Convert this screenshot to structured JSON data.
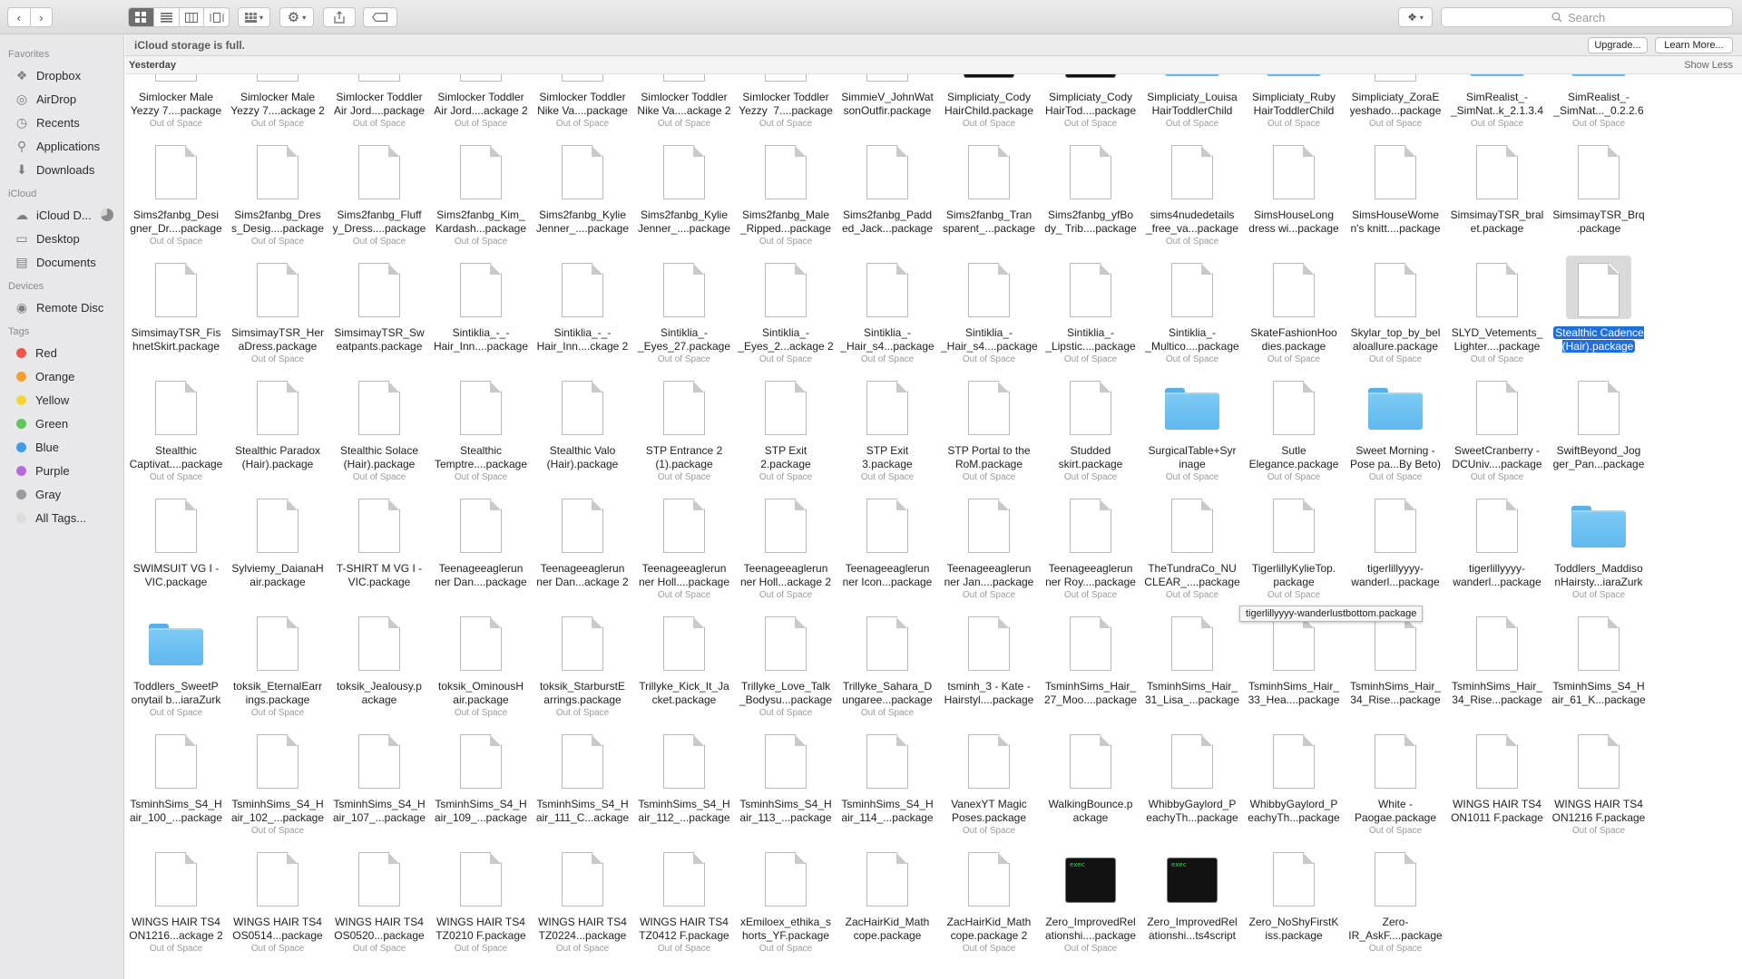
{
  "toolbar": {
    "nav_back_icon": "chevron-left",
    "nav_forward_icon": "chevron-right",
    "view_modes": [
      "icon-view",
      "list-view",
      "column-view",
      "coverflow-view"
    ],
    "arrange_icon": "grid-arrange",
    "action_icon": "gear",
    "share_icon": "share",
    "tags_icon": "tag",
    "dropbox_icon": "dropbox",
    "search_placeholder": "Search"
  },
  "sidebar": {
    "favorites_label": "Favorites",
    "favorites": [
      {
        "label": "Dropbox",
        "icon": "dropbox-icon"
      },
      {
        "label": "AirDrop",
        "icon": "airdrop-icon"
      },
      {
        "label": "Recents",
        "icon": "clock-icon"
      },
      {
        "label": "Applications",
        "icon": "applications-icon"
      },
      {
        "label": "Downloads",
        "icon": "download-icon"
      }
    ],
    "icloud_label": "iCloud",
    "icloud": [
      {
        "label": "iCloud D...",
        "icon": "cloud-icon"
      },
      {
        "label": "Desktop",
        "icon": "desktop-icon"
      },
      {
        "label": "Documents",
        "icon": "document-icon"
      }
    ],
    "devices_label": "Devices",
    "devices": [
      {
        "label": "Remote Disc",
        "icon": "disc-icon"
      }
    ],
    "tags_label": "Tags",
    "tags": [
      {
        "label": "Red",
        "color": "#f0544f"
      },
      {
        "label": "Orange",
        "color": "#f6a02d"
      },
      {
        "label": "Yellow",
        "color": "#f8d435"
      },
      {
        "label": "Green",
        "color": "#5fc65a"
      },
      {
        "label": "Blue",
        "color": "#3d9be9"
      },
      {
        "label": "Purple",
        "color": "#b66bd9"
      },
      {
        "label": "Gray",
        "color": "#9b9b9b"
      },
      {
        "label": "All Tags...",
        "color": "#dcdcdc"
      }
    ]
  },
  "banner": {
    "message": "iCloud storage is full.",
    "upgrade_label": "Upgrade...",
    "learn_more_label": "Learn More..."
  },
  "group": {
    "title": "Yesterday",
    "show_less_label": "Show Less"
  },
  "tooltip": "tigerlillyyyy-wanderlustbottom.package",
  "accent_color": "#1d6ee2",
  "files": [
    {
      "name": "Simlocker Male\nYezzy 7....package",
      "sub": "Out of Space",
      "kind": "doc"
    },
    {
      "name": "Simlocker Male\nYezzy 7....ackage 2",
      "sub": "Out of Space",
      "kind": "doc"
    },
    {
      "name": "Simlocker Toddler\nAir Jord....package",
      "sub": "Out of Space",
      "kind": "doc"
    },
    {
      "name": "Simlocker Toddler\nAir Jord....ackage 2",
      "sub": "Out of Space",
      "kind": "doc"
    },
    {
      "name": "Simlocker Toddler\nNike Va....package",
      "sub": "Out of Space",
      "kind": "doc"
    },
    {
      "name": "Simlocker Toddler\nNike Va....ackage 2",
      "sub": "Out of Space",
      "kind": "doc"
    },
    {
      "name": "Simlocker Toddler\nYezzy  7....package",
      "sub": "Out of Space",
      "kind": "doc"
    },
    {
      "name": "SimmieV_JohnWat\nsonOutfir.package",
      "sub": "",
      "kind": "doc"
    },
    {
      "name": "Simpliciaty_Cody\nHairChild.package",
      "sub": "Out of Space",
      "kind": "exec"
    },
    {
      "name": "Simpliciaty_Cody\nHairTod....package",
      "sub": "Out of Space",
      "kind": "exec"
    },
    {
      "name": "Simpliciaty_Louisa\nHairToddlerChild",
      "sub": "Out of Space",
      "kind": "folder"
    },
    {
      "name": "Simpliciaty_Ruby\nHairToddlerChild",
      "sub": "Out of Space",
      "kind": "folder"
    },
    {
      "name": "Simpliciaty_ZoraE\nyeshado...package",
      "sub": "Out of Space",
      "kind": "doc"
    },
    {
      "name": "SimRealist_-\n_SimNat..k_2.1.3.4",
      "sub": "Out of Space",
      "kind": "folder"
    },
    {
      "name": "SimRealist_-\n_SimNat..._0.2.2.6",
      "sub": "Out of Space",
      "kind": "folder"
    },
    {
      "name": "Sims2fanbg_Desi\ngner_Dr....package",
      "sub": "Out of Space",
      "kind": "doc"
    },
    {
      "name": "Sims2fanbg_Dres\ns_Desig....package",
      "sub": "Out of Space",
      "kind": "doc"
    },
    {
      "name": "Sims2fanbg_Fluff\ny_Dress....package",
      "sub": "Out of Space",
      "kind": "doc"
    },
    {
      "name": "Sims2fanbg_Kim_\nKardash...package",
      "sub": "Out of Space",
      "kind": "doc"
    },
    {
      "name": "Sims2fanbg_Kylie\nJenner_....package",
      "sub": "",
      "kind": "doc"
    },
    {
      "name": "Sims2fanbg_Kylie\nJenner_....package",
      "sub": "",
      "kind": "doc"
    },
    {
      "name": "Sims2fanbg_Male\n_Ripped...package",
      "sub": "Out of Space",
      "kind": "doc"
    },
    {
      "name": "Sims2fanbg_Padd\ned_Jack...package",
      "sub": "",
      "kind": "doc"
    },
    {
      "name": "Sims2fanbg_Tran\nsparent_...package",
      "sub": "",
      "kind": "doc"
    },
    {
      "name": "Sims2fanbg_yfBo\ndy_ Trib....package",
      "sub": "",
      "kind": "doc"
    },
    {
      "name": "sims4nudedetails\n_free_va...package",
      "sub": "Out of Space",
      "kind": "doc"
    },
    {
      "name": "SimsHouseLong\ndress wi...package",
      "sub": "",
      "kind": "doc"
    },
    {
      "name": "SimsHouseWome\nn's knitt....package",
      "sub": "",
      "kind": "doc"
    },
    {
      "name": "SimsimayTSR_bral\net.package",
      "sub": "",
      "kind": "doc"
    },
    {
      "name": "SimsimayTSR_Brq\n.package",
      "sub": "",
      "kind": "doc"
    },
    {
      "name": "SimsimayTSR_Fis\nhnetSkirt.package",
      "sub": "",
      "kind": "doc"
    },
    {
      "name": "SimsimayTSR_Her\naDress.package",
      "sub": "Out of Space",
      "kind": "doc"
    },
    {
      "name": "SimsimayTSR_Sw\neatpants.package",
      "sub": "",
      "kind": "doc"
    },
    {
      "name": "Sintiklia_-_-\nHair_Inn....package",
      "sub": "",
      "kind": "doc"
    },
    {
      "name": "Sintiklia_-_-\nHair_Inn....ckage 2",
      "sub": "",
      "kind": "doc"
    },
    {
      "name": "Sintiklia_-\n_Eyes_27.package",
      "sub": "Out of Space",
      "kind": "doc"
    },
    {
      "name": "Sintiklia_-\n_Eyes_2...ackage 2",
      "sub": "Out of Space",
      "kind": "doc"
    },
    {
      "name": "Sintiklia_-\n_Hair_s4...package",
      "sub": "Out of Space",
      "kind": "doc"
    },
    {
      "name": "Sintiklia_-\n_Hair_s4....package",
      "sub": "Out of Space",
      "kind": "doc"
    },
    {
      "name": "Sintiklia_-\n_Lipstic....package",
      "sub": "Out of Space",
      "kind": "doc"
    },
    {
      "name": "Sintiklia_-\n_Multico....package",
      "sub": "Out of Space",
      "kind": "doc"
    },
    {
      "name": "SkateFashionHoo\ndies.package",
      "sub": "Out of Space",
      "kind": "doc"
    },
    {
      "name": "Skylar_top_by_bel\naloallure.package",
      "sub": "Out of Space",
      "kind": "doc"
    },
    {
      "name": "SLYD_Vetements_\nLighter....package",
      "sub": "Out of Space",
      "kind": "doc"
    },
    {
      "name": "Stealthic Cadence\n(Hair).package",
      "sub": "",
      "kind": "doc",
      "selected": true
    },
    {
      "name": "Stealthic\nCaptivat....package",
      "sub": "Out of Space",
      "kind": "doc"
    },
    {
      "name": "Stealthic Paradox\n(Hair).package",
      "sub": "",
      "kind": "doc"
    },
    {
      "name": "Stealthic Solace\n(Hair).package",
      "sub": "Out of Space",
      "kind": "doc"
    },
    {
      "name": "Stealthic\nTemptre....package",
      "sub": "Out of Space",
      "kind": "doc"
    },
    {
      "name": "Stealthic Valo\n(Hair).package",
      "sub": "",
      "kind": "doc"
    },
    {
      "name": "STP Entrance 2\n(1).package",
      "sub": "Out of Space",
      "kind": "doc"
    },
    {
      "name": "STP Exit\n2.package",
      "sub": "Out of Space",
      "kind": "doc"
    },
    {
      "name": "STP Exit\n3.package",
      "sub": "Out of Space",
      "kind": "doc"
    },
    {
      "name": "STP Portal to the\nRoM.package",
      "sub": "Out of Space",
      "kind": "doc"
    },
    {
      "name": "Studded\nskirt.package",
      "sub": "Out of Space",
      "kind": "doc"
    },
    {
      "name": "SurgicalTable+Syr\ninage",
      "sub": "Out of Space",
      "kind": "folder"
    },
    {
      "name": "Sutle\nElegance.package",
      "sub": "Out of Space",
      "kind": "doc"
    },
    {
      "name": "Sweet Morning -\nPose pa...By Beto)",
      "sub": "Out of Space",
      "kind": "folder"
    },
    {
      "name": "SweetCranberry -\nDCUniv....package",
      "sub": "Out of Space",
      "kind": "doc"
    },
    {
      "name": "SwiftBeyond_Jog\nger_Pan...package",
      "sub": "",
      "kind": "doc"
    },
    {
      "name": "SWIMSUIT VG I -\nVIC.package",
      "sub": "",
      "kind": "doc"
    },
    {
      "name": "Sylviemy_DaianaH\nair.package",
      "sub": "",
      "kind": "doc"
    },
    {
      "name": "T-SHIRT M VG I -\nVIC.package",
      "sub": "",
      "kind": "doc"
    },
    {
      "name": "Teenageeaglerun\nner Dan....package",
      "sub": "",
      "kind": "doc"
    },
    {
      "name": "Teenageeaglerun\nner Dan...ackage 2",
      "sub": "",
      "kind": "doc"
    },
    {
      "name": "Teenageeaglerun\nner Holl....package",
      "sub": "Out of Space",
      "kind": "doc"
    },
    {
      "name": "Teenageeaglerun\nner Holl...ackage 2",
      "sub": "Out of Space",
      "kind": "doc"
    },
    {
      "name": "Teenageeaglerun\nner Icon...package",
      "sub": "",
      "kind": "doc"
    },
    {
      "name": "Teenageeaglerun\nner Jan....package",
      "sub": "Out of Space",
      "kind": "doc"
    },
    {
      "name": "Teenageeaglerun\nner Roy....package",
      "sub": "Out of Space",
      "kind": "doc"
    },
    {
      "name": "TheTundraCo_NU\nCLEAR_....package",
      "sub": "Out of Space",
      "kind": "doc"
    },
    {
      "name": "TigerlillyKylieTop.\npackage",
      "sub": "Out of Space",
      "kind": "doc"
    },
    {
      "name": "tigerlillyyyy-\nwanderl...package",
      "sub": "",
      "kind": "doc"
    },
    {
      "name": "tigerlillyyyy-\nwanderl...package",
      "sub": "",
      "kind": "doc"
    },
    {
      "name": "Toddlers_Maddiso\nnHairsty...iaraZurk",
      "sub": "Out of Space",
      "kind": "folder"
    },
    {
      "name": "Toddlers_SweetP\nonytail b...iaraZurk",
      "sub": "Out of Space",
      "kind": "folder"
    },
    {
      "name": "toksik_EternalEarr\nings.package",
      "sub": "Out of Space",
      "kind": "doc"
    },
    {
      "name": "toksik_Jealousy.p\nackage",
      "sub": "",
      "kind": "doc"
    },
    {
      "name": "toksik_OminousH\nair.package",
      "sub": "Out of Space",
      "kind": "doc"
    },
    {
      "name": "toksik_StarburstE\narrings.package",
      "sub": "Out of Space",
      "kind": "doc"
    },
    {
      "name": "Trillyke_Kick_It_Ja\ncket.package",
      "sub": "",
      "kind": "doc"
    },
    {
      "name": "Trillyke_Love_Talk\n_Bodysu...package",
      "sub": "Out of Space",
      "kind": "doc"
    },
    {
      "name": "Trillyke_Sahara_D\nungaree...package",
      "sub": "Out of Space",
      "kind": "doc"
    },
    {
      "name": "tsminh_3 - Kate -\nHairstyl....package",
      "sub": "",
      "kind": "doc"
    },
    {
      "name": "TsminhSims_Hair_\n27_Moo....package",
      "sub": "",
      "kind": "doc"
    },
    {
      "name": "TsminhSims_Hair_\n31_Lisa_...package",
      "sub": "",
      "kind": "doc"
    },
    {
      "name": "TsminhSims_Hair_\n33_Hea....package",
      "sub": "",
      "kind": "doc"
    },
    {
      "name": "TsminhSims_Hair_\n34_Rise...package",
      "sub": "",
      "kind": "doc"
    },
    {
      "name": "TsminhSims_Hair_\n34_Rise...package",
      "sub": "",
      "kind": "doc"
    },
    {
      "name": "TsminhSims_S4_H\nair_61_K...package",
      "sub": "",
      "kind": "doc"
    },
    {
      "name": "TsminhSims_S4_H\nair_100_...package",
      "sub": "",
      "kind": "doc"
    },
    {
      "name": "TsminhSims_S4_H\nair_102_...package",
      "sub": "Out of Space",
      "kind": "doc"
    },
    {
      "name": "TsminhSims_S4_H\nair_107_...package",
      "sub": "",
      "kind": "doc"
    },
    {
      "name": "TsminhSims_S4_H\nair_109_...package",
      "sub": "",
      "kind": "doc"
    },
    {
      "name": "TsminhSims_S4_H\nair_111_C...ackage",
      "sub": "",
      "kind": "doc"
    },
    {
      "name": "TsminhSims_S4_H\nair_112_...package",
      "sub": "",
      "kind": "doc"
    },
    {
      "name": "TsminhSims_S4_H\nair_113_...package",
      "sub": "",
      "kind": "doc"
    },
    {
      "name": "TsminhSims_S4_H\nair_114_...package",
      "sub": "",
      "kind": "doc"
    },
    {
      "name": "VanexYT Magic\nPoses.package",
      "sub": "Out of Space",
      "kind": "doc"
    },
    {
      "name": "WalkingBounce.p\nackage",
      "sub": "",
      "kind": "doc"
    },
    {
      "name": "WhibbyGaylord_P\neachyTh...package",
      "sub": "",
      "kind": "doc"
    },
    {
      "name": "WhibbyGaylord_P\neachyTh...package",
      "sub": "",
      "kind": "doc"
    },
    {
      "name": "White -\nPaogae.package",
      "sub": "Out of Space",
      "kind": "doc"
    },
    {
      "name": "WINGS HAIR TS4\nON1011 F.package",
      "sub": "",
      "kind": "doc"
    },
    {
      "name": "WINGS HAIR TS4\nON1216 F.package",
      "sub": "Out of Space",
      "kind": "doc"
    },
    {
      "name": "WINGS HAIR TS4\nON1216...ackage 2",
      "sub": "Out of Space",
      "kind": "doc"
    },
    {
      "name": "WINGS HAIR TS4\nOS0514...package",
      "sub": "Out of Space",
      "kind": "doc"
    },
    {
      "name": "WINGS HAIR TS4\nOS0520...package",
      "sub": "Out of Space",
      "kind": "doc"
    },
    {
      "name": "WINGS HAIR TS4\nTZ0210 F.package",
      "sub": "Out of Space",
      "kind": "doc"
    },
    {
      "name": "WINGS HAIR TS4\nTZ0224...package",
      "sub": "Out of Space",
      "kind": "doc"
    },
    {
      "name": "WINGS HAIR TS4\nTZ0412 F.package",
      "sub": "Out of Space",
      "kind": "doc"
    },
    {
      "name": "xEmiloex_ethika_s\nhorts_YF.package",
      "sub": "Out of Space",
      "kind": "doc"
    },
    {
      "name": "ZacHairKid_Math\ncope.package",
      "sub": "",
      "kind": "doc"
    },
    {
      "name": "ZacHairKid_Math\ncope.package 2",
      "sub": "Out of Space",
      "kind": "doc"
    },
    {
      "name": "Zero_ImprovedRel\nationshi....package",
      "sub": "Out of Space",
      "kind": "exec"
    },
    {
      "name": "Zero_ImprovedRel\nationshi...ts4script",
      "sub": "",
      "kind": "exec"
    },
    {
      "name": "Zero_NoShyFirstK\niss.package",
      "sub": "",
      "kind": "doc"
    },
    {
      "name": "Zero-\nIR_AskF....package",
      "sub": "Out of Space",
      "kind": "doc"
    }
  ]
}
